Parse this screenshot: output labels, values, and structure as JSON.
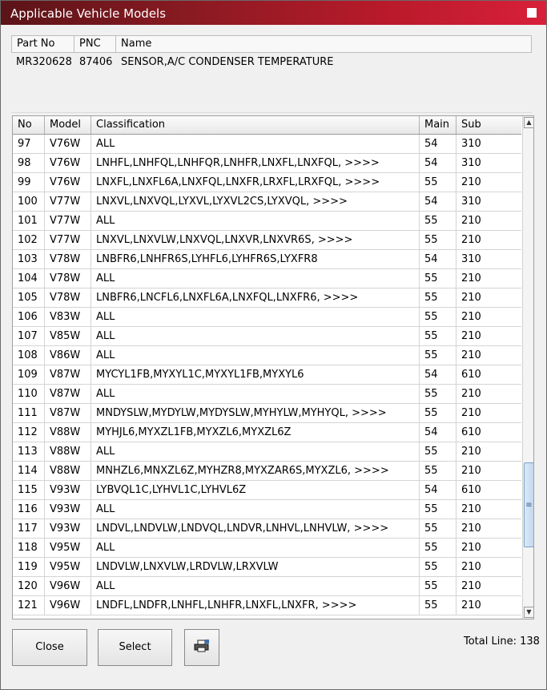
{
  "window": {
    "title": "Applicable Vehicle Models"
  },
  "part_header": {
    "labels": [
      "Part No",
      "PNC",
      "Name"
    ],
    "part_no": "MR320628",
    "pnc": "87406",
    "name": "SENSOR,A/C CONDENSER TEMPERATURE"
  },
  "table": {
    "columns": [
      "No",
      "Model",
      "Classification",
      "Main",
      "Sub"
    ],
    "rows": [
      [
        "97",
        "V76W",
        "ALL",
        "54",
        "310"
      ],
      [
        "98",
        "V76W",
        "LNHFL,LNHFQL,LNHFQR,LNHFR,LNXFL,LNXFQL,  >>>>",
        "54",
        "310"
      ],
      [
        "99",
        "V76W",
        "LNXFL,LNXFL6A,LNXFQL,LNXFR,LRXFL,LRXFQL,  >>>>",
        "55",
        "210"
      ],
      [
        "100",
        "V77W",
        "LNXVL,LNXVQL,LYXVL,LYXVL2CS,LYXVQL,  >>>>",
        "54",
        "310"
      ],
      [
        "101",
        "V77W",
        "ALL",
        "55",
        "210"
      ],
      [
        "102",
        "V77W",
        "LNXVL,LNXVLW,LNXVQL,LNXVR,LNXVR6S,  >>>>",
        "55",
        "210"
      ],
      [
        "103",
        "V78W",
        "LNBFR6,LNHFR6S,LYHFL6,LYHFR6S,LYXFR8",
        "54",
        "310"
      ],
      [
        "104",
        "V78W",
        "ALL",
        "55",
        "210"
      ],
      [
        "105",
        "V78W",
        "LNBFR6,LNCFL6,LNXFL6A,LNXFQL,LNXFR6,  >>>>",
        "55",
        "210"
      ],
      [
        "106",
        "V83W",
        "ALL",
        "55",
        "210"
      ],
      [
        "107",
        "V85W",
        "ALL",
        "55",
        "210"
      ],
      [
        "108",
        "V86W",
        "ALL",
        "55",
        "210"
      ],
      [
        "109",
        "V87W",
        "MYCYL1FB,MYXYL1C,MYXYL1FB,MYXYL6",
        "54",
        "610"
      ],
      [
        "110",
        "V87W",
        "ALL",
        "55",
        "210"
      ],
      [
        "111",
        "V87W",
        "MNDYSLW,MYDYLW,MYDYSLW,MYHYLW,MYHYQL,  >>>>",
        "55",
        "210"
      ],
      [
        "112",
        "V88W",
        "MYHJL6,MYXZL1FB,MYXZL6,MYXZL6Z",
        "54",
        "610"
      ],
      [
        "113",
        "V88W",
        "ALL",
        "55",
        "210"
      ],
      [
        "114",
        "V88W",
        "MNHZL6,MNXZL6Z,MYHZR8,MYXZAR6S,MYXZL6,  >>>>",
        "55",
        "210"
      ],
      [
        "115",
        "V93W",
        "LYBVQL1C,LYHVL1C,LYHVL6Z",
        "54",
        "610"
      ],
      [
        "116",
        "V93W",
        "ALL",
        "55",
        "210"
      ],
      [
        "117",
        "V93W",
        "LNDVL,LNDVLW,LNDVQL,LNDVR,LNHVL,LNHVLW,  >>>>",
        "55",
        "210"
      ],
      [
        "118",
        "V95W",
        "ALL",
        "55",
        "210"
      ],
      [
        "119",
        "V95W",
        "LNDVLW,LNXVLW,LRDVLW,LRXVLW",
        "55",
        "210"
      ],
      [
        "120",
        "V96W",
        "ALL",
        "55",
        "210"
      ],
      [
        "121",
        "V96W",
        "LNDFL,LNDFR,LNHFL,LNHFR,LNXFL,LNXFR,  >>>>",
        "55",
        "210"
      ]
    ]
  },
  "buttons": {
    "close": "Close",
    "select": "Select",
    "print_icon": "printer-icon"
  },
  "footer": {
    "total": "Total Line: 138"
  },
  "scroll": {
    "position_fraction": 0.72
  }
}
